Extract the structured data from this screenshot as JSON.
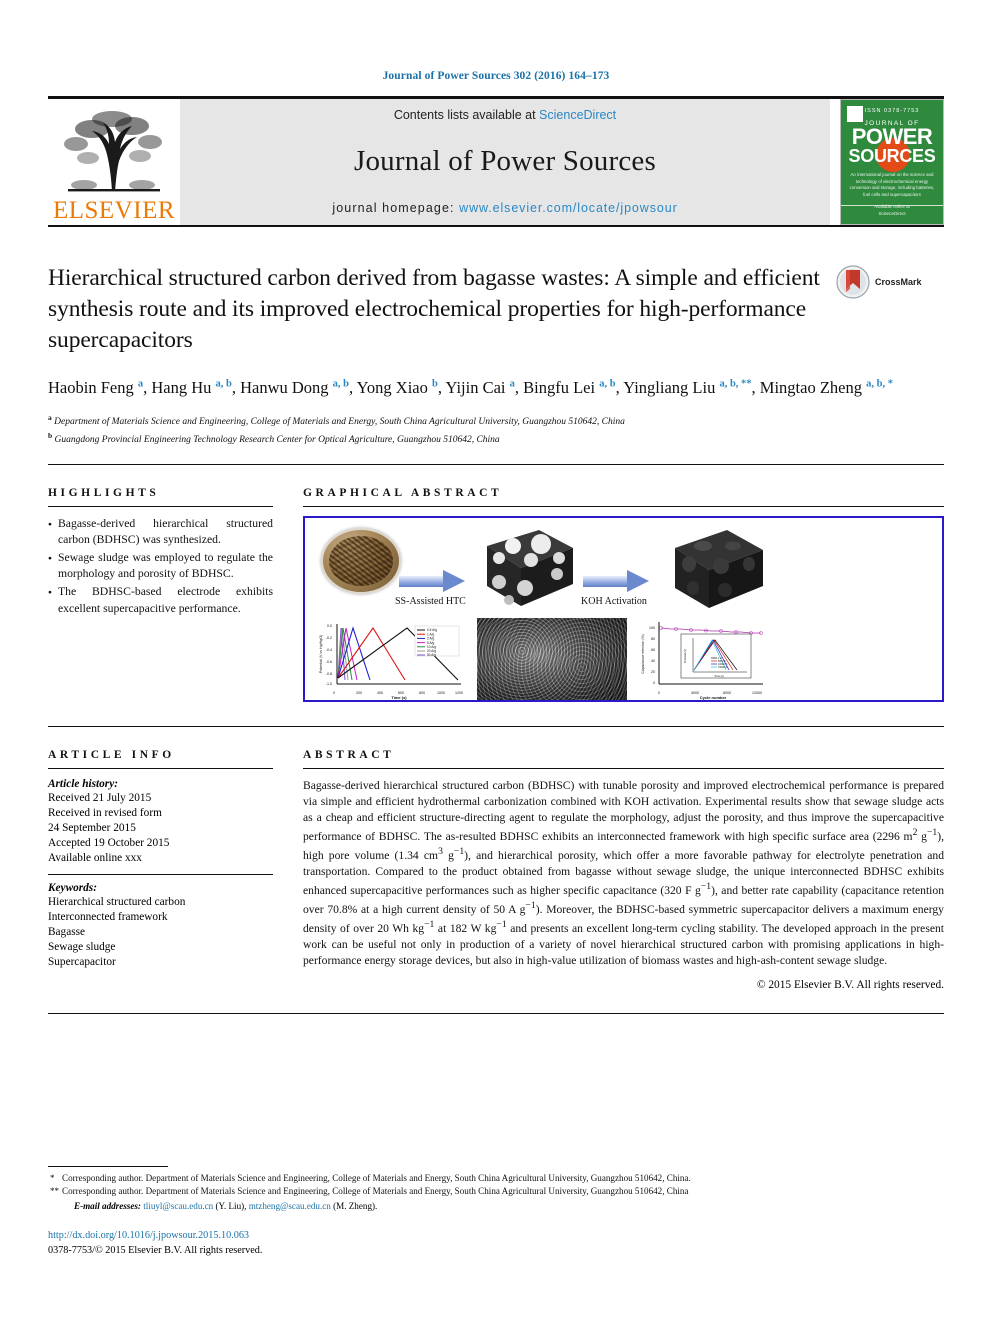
{
  "running_head": "Journal of Power Sources 302 (2016) 164–173",
  "masthead": {
    "publisher_name": "ELSEVIER",
    "contents_prefix": "Contents lists available at ",
    "contents_link": "ScienceDirect",
    "journal_title": "Journal of Power Sources",
    "homepage_prefix": "journal homepage: ",
    "homepage_url": "www.elsevier.com/locate/jpowsour",
    "cover": {
      "top_line": "ISSN 0378-7753",
      "journal_of": "JOURNAL OF",
      "power": "POWER",
      "sources": "SOURCES",
      "blurb": "An international journal on the science and technology of electrochemical energy conversion and storage, including batteries, fuel cells and supercapacitors",
      "footer_line1": "Available online at",
      "footer_line2": "ScienceDirect"
    }
  },
  "article": {
    "title": "Hierarchical structured carbon derived from bagasse wastes: A simple and efficient synthesis route and its improved electrochemical properties for high-performance supercapacitors",
    "crossmark_label": "CrossMark",
    "authors_html": "Haobin Feng <sup>a</sup>, Hang Hu <sup>a, b</sup>, Hanwu Dong <sup>a, b</sup>, Yong Xiao <sup>b</sup>, Yijin Cai <sup>a</sup>, Bingfu Lei <sup>a, b</sup>, Yingliang Liu <sup>a, b, **</sup>, Mingtao Zheng <sup>a, b, *</sup>",
    "affiliations": [
      "Department of Materials Science and Engineering, College of Materials and Energy, South China Agricultural University, Guangzhou 510642, China",
      "Guangdong Provincial Engineering Technology Research Center for Optical Agriculture, Guangzhou 510642, China"
    ],
    "affiliation_marks": [
      "a",
      "b"
    ]
  },
  "highlights": {
    "heading": "HIGHLIGHTS",
    "items": [
      "Bagasse-derived hierarchical structured carbon (BDHSC) was synthesized.",
      "Sewage sludge was employed to regulate the morphology and porosity of BDHSC.",
      "The BDHSC-based electrode exhibits excellent supercapacitive performance."
    ]
  },
  "graphical_abstract": {
    "heading": "GRAPHICAL ABSTRACT",
    "border_color": "#2a18c9",
    "step_labels": [
      "SS-Assisted HTC",
      "KOH Activation"
    ],
    "left_plot": {
      "xlabel": "Time (s)",
      "ylabel": "Potential (V vs Hg/HgO)",
      "legend": [
        "0.5 A/g",
        "1 A/g",
        "2 A/g",
        "5 A/g",
        "10 A/g",
        "20 A/g",
        "50 A/g"
      ],
      "xticks": [
        "0",
        "200",
        "400",
        "600",
        "800",
        "1000",
        "1200"
      ],
      "yticks": [
        "0.0",
        "-0.2",
        "-0.4",
        "-0.6",
        "-0.8",
        "-1.0"
      ]
    },
    "right_plot": {
      "xlabel": "Cycle number",
      "ylabel": "Capacitance retention (%)",
      "xticks": [
        "0",
        "4000",
        "8000",
        "12000"
      ],
      "yticks": [
        "0",
        "20",
        "40",
        "60",
        "80",
        "100"
      ],
      "inset": {
        "xlabel": "Time (s)",
        "ylabel": "Potential (V)",
        "legend": [
          "1 st",
          "5000 th",
          "10000 th",
          "15000 th"
        ]
      }
    }
  },
  "article_info": {
    "heading": "ARTICLE INFO",
    "history_label": "Article history:",
    "history": [
      "Received 21 July 2015",
      "Received in revised form",
      "24 September 2015",
      "Accepted 19 October 2015",
      "Available online xxx"
    ],
    "keywords_label": "Keywords:",
    "keywords": [
      "Hierarchical structured carbon",
      "Interconnected framework",
      "Bagasse",
      "Sewage sludge",
      "Supercapacitor"
    ]
  },
  "abstract": {
    "heading": "ABSTRACT",
    "body_html": "Bagasse-derived hierarchical structured carbon (BDHSC) with tunable porosity and improved electrochemical performance is prepared via simple and efficient hydrothermal carbonization combined with KOH activation. Experimental results show that sewage sludge acts as a cheap and efficient structure-directing agent to regulate the morphology, adjust the porosity, and thus improve the supercapacitive performance of BDHSC. The as-resulted BDHSC exhibits an interconnected framework with high specific surface area (2296 m<sup>2</sup> g<sup>&#8722;1</sup>), high pore volume (1.34 cm<sup>3</sup> g<sup>&#8722;1</sup>), and hierarchical porosity, which offer a more favorable pathway for electrolyte penetration and transportation. Compared to the product obtained from bagasse without sewage sludge, the unique interconnected BDHSC exhibits enhanced supercapacitive performances such as higher specific capacitance (320 F g<sup>&#8722;1</sup>), and better rate capability (capacitance retention over 70.8% at a high current density of 50 A g<sup>&#8722;1</sup>). Moreover, the BDHSC-based symmetric supercapacitor delivers a maximum energy density of over 20 Wh kg<sup>&#8722;1</sup> at 182 W kg<sup>&#8722;1</sup> and presents an excellent long-term cycling stability. The developed approach in the present work can be useful not only in production of a variety of novel hierarchical structured carbon with promising applications in high-performance energy storage devices, but also in high-value utilization of biomass wastes and high-ash-content sewage sludge.",
    "copyright": "© 2015 Elsevier B.V. All rights reserved."
  },
  "footnotes": {
    "mark_single": "*",
    "mark_double": "**",
    "corresponding_1": "Corresponding author. Department of Materials Science and Engineering, College of Materials and Energy, South China Agricultural University, Guangzhou 510642, China.",
    "corresponding_2": "Corresponding author. Department of Materials Science and Engineering, College of Materials and Energy, South China Agricultural University, Guangzhou 510642, China",
    "email_label": "E-mail addresses:",
    "email_1": "tliuyl@scau.edu.cn",
    "email_1_owner": "(Y. Liu),",
    "email_2": "mtzheng@scau.edu.cn",
    "email_2_owner": "(M. Zheng).",
    "doi": "http://dx.doi.org/10.1016/j.jpowsour.2015.10.063",
    "issn": "0378-7753/© 2015 Elsevier B.V. All rights reserved."
  }
}
